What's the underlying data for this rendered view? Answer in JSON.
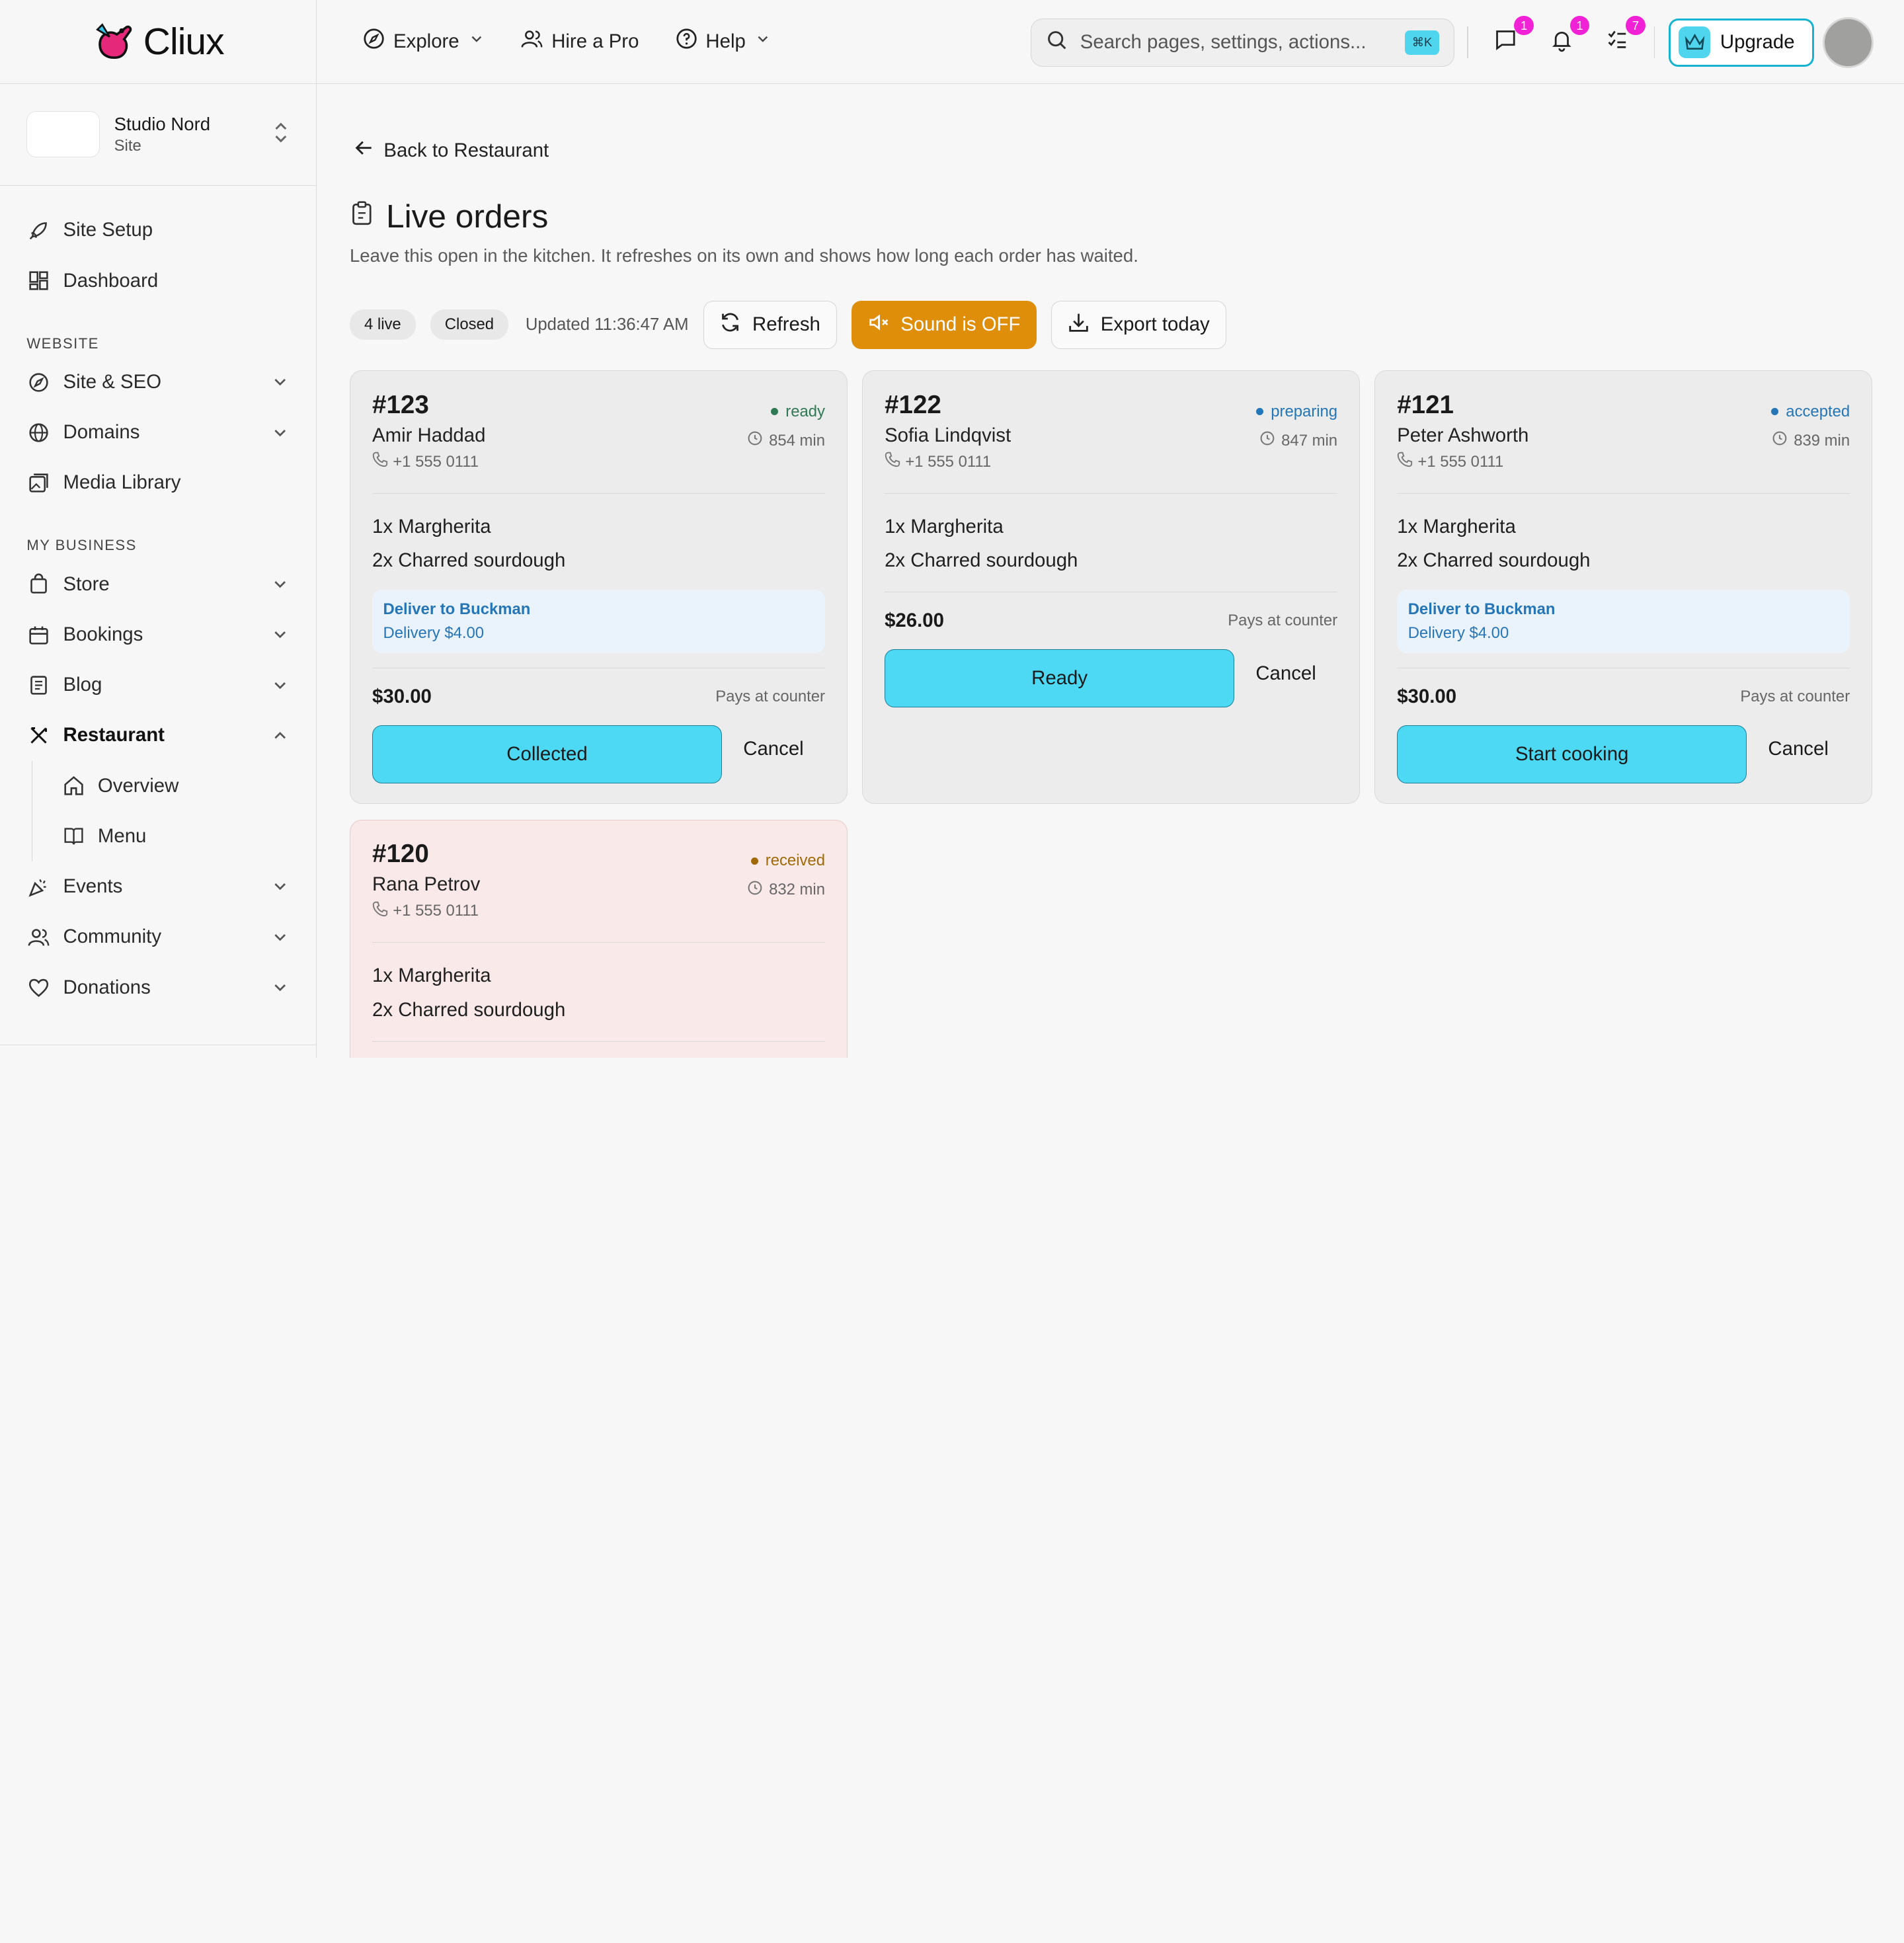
{
  "brand": {
    "name": "Cliux"
  },
  "site": {
    "name": "Studio Nord",
    "type": "Site"
  },
  "sidebar": {
    "top_items": [
      {
        "label": "Site Setup",
        "icon": "rocket-icon"
      },
      {
        "label": "Dashboard",
        "icon": "dashboard-icon"
      }
    ],
    "sections": [
      {
        "label": "WEBSITE",
        "items": [
          {
            "label": "Site & SEO",
            "icon": "compass-icon"
          },
          {
            "label": "Domains",
            "icon": "globe-icon"
          },
          {
            "label": "Media Library",
            "icon": "image-icon"
          }
        ]
      },
      {
        "label": "MY BUSINESS",
        "items": [
          {
            "label": "Store",
            "icon": "store-icon"
          },
          {
            "label": "Bookings",
            "icon": "calendar-icon"
          },
          {
            "label": "Blog",
            "icon": "blog-icon"
          },
          {
            "label": "Restaurant",
            "icon": "utensils-icon"
          },
          {
            "label": "Overview",
            "icon": "home-icon"
          },
          {
            "label": "Menu",
            "icon": "book-icon"
          },
          {
            "label": "Events",
            "icon": "party-icon"
          },
          {
            "label": "Community",
            "icon": "users-icon"
          },
          {
            "label": "Donations",
            "icon": "heart-icon"
          }
        ]
      }
    ]
  },
  "topbar": {
    "explore": "Explore",
    "hire": "Hire a Pro",
    "help": "Help",
    "search_placeholder": "Search pages, settings, actions...",
    "shortcut": "⌘K",
    "messages_count": "1",
    "notifications_count": "1",
    "tasks_count": "7",
    "upgrade": "Upgrade"
  },
  "page": {
    "back": "Back to Restaurant",
    "title": "Live orders",
    "subtitle": "Leave this open in the kitchen. It refreshes on its own and shows how long each order has waited.",
    "live_pill": "4 live",
    "closed_pill": "Closed",
    "updated": "Updated 11:36:47 AM",
    "refresh": "Refresh",
    "sound": "Sound is OFF",
    "export": "Export today"
  },
  "colors": {
    "accent": "#4dd8f3",
    "sound_off": "#df8e0a",
    "badge": "#f121d6"
  },
  "orders": [
    {
      "number": "#123",
      "customer": "Amir Haddad",
      "phone": "+1 555 0111",
      "status": "ready",
      "waited": "854 min",
      "items": [
        "1x Margherita",
        "2x Charred sourdough"
      ],
      "delivery_to": "Deliver to Buckman",
      "delivery_fee": "Delivery $4.00",
      "total": "$30.00",
      "payment": "Pays at counter",
      "primary_action": "Collected",
      "cancel": "Cancel"
    },
    {
      "number": "#122",
      "customer": "Sofia Lindqvist",
      "phone": "+1 555 0111",
      "status": "preparing",
      "waited": "847 min",
      "items": [
        "1x Margherita",
        "2x Charred sourdough"
      ],
      "total": "$26.00",
      "payment": "Pays at counter",
      "primary_action": "Ready",
      "cancel": "Cancel"
    },
    {
      "number": "#121",
      "customer": "Peter Ashworth",
      "phone": "+1 555 0111",
      "status": "accepted",
      "waited": "839 min",
      "items": [
        "1x Margherita",
        "2x Charred sourdough"
      ],
      "delivery_to": "Deliver to Buckman",
      "delivery_fee": "Delivery $4.00",
      "total": "$30.00",
      "payment": "Pays at counter",
      "primary_action": "Start cooking",
      "cancel": "Cancel"
    },
    {
      "number": "#120",
      "customer": "Rana Petrov",
      "phone": "+1 555 0111",
      "status": "received",
      "waited": "832 min",
      "items": [
        "1x Margherita",
        "2x Charred sourdough"
      ]
    }
  ]
}
